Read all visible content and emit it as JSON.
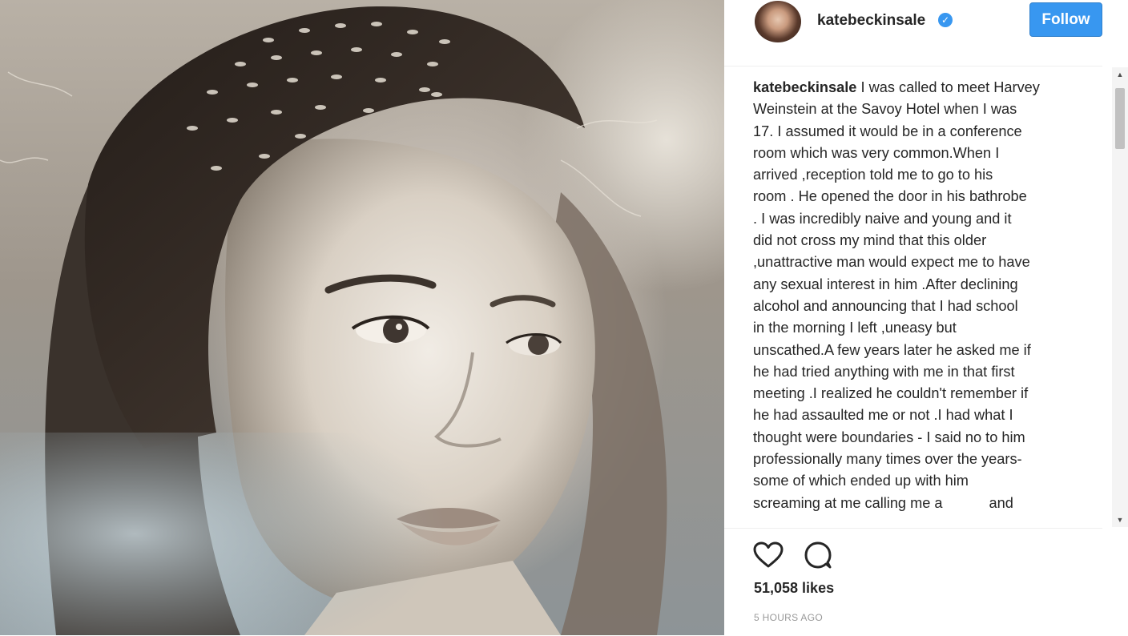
{
  "photo": {
    "alt": "Sepia portrait photograph"
  },
  "post": {
    "username": "katebeckinsale",
    "verified_icon": "verified-badge-icon",
    "follow_label": "Follow",
    "caption_user": "katebeckinsale",
    "caption_lines": [
      "I was called to meet Harvey",
      "Weinstein at the Savoy Hotel when I was",
      "17. I assumed it would be in a conference",
      "room which was very common.When I",
      "arrived ,reception told me to go to his",
      "room . He opened the door in his bathrobe",
      ". I was incredibly naive and young and it",
      "did not cross my mind that this older",
      ",unattractive man would expect me to have",
      "any sexual interest in him .After declining",
      "alcohol and announcing that I had school",
      "in the morning I left ,uneasy but",
      "unscathed.A few years later he asked me if",
      "he had tried anything with me in that first",
      "meeting .I realized he couldn't remember if",
      "he had assaulted me or not .I had what I",
      "thought were boundaries - I said no to him",
      "professionally many times over the years-",
      "some of which ended up with him"
    ],
    "caption_last_start": "screaming at me calling me a",
    "caption_last_end": "and",
    "likes": "51,058 likes",
    "timestamp": "5 HOURS AGO",
    "icons": {
      "like": "heart-icon",
      "comment": "comment-icon",
      "scroll_up": "triangle-up-icon",
      "scroll_down": "triangle-down-icon"
    }
  },
  "colors": {
    "accent": "#3897f0",
    "text": "#262626",
    "muted": "#999999"
  }
}
